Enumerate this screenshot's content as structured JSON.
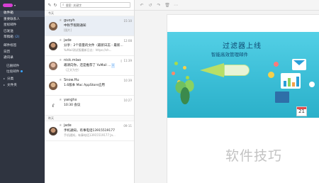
{
  "sidebar": {
    "items": [
      {
        "label": "收件箱",
        "active": true
      },
      {
        "label": "重要联系人"
      },
      {
        "label": "星标邮件"
      },
      {
        "label": "已发送"
      },
      {
        "label": "草稿箱",
        "count": "(2)"
      },
      {
        "label": "邮件标签"
      },
      {
        "label": "日历"
      },
      {
        "label": "通讯录"
      },
      {
        "label": "已删邮件"
      },
      {
        "label": "垃圾邮件"
      },
      {
        "label": "分类"
      },
      {
        "label": "文件夹"
      }
    ]
  },
  "list": {
    "search_placeholder": "搜索: 关键字",
    "groups": [
      {
        "label": "今天"
      },
      {
        "label": "昨天"
      }
    ],
    "mails": [
      {
        "sender": "guoyh",
        "time": "15:10",
        "subject": "中秋节假期通知",
        "preview": "[图片]"
      },
      {
        "sender": "jade",
        "time": "12:08",
        "subject": "分享：2个容量的文件（最新日志 - 最新...",
        "preview": "YuMail测试版最新日志：https://sh..."
      },
      {
        "sender": "nick.mlao",
        "time": "11:39",
        "subject": "邀请向你，还是推荐了 YuMail ...",
        "preview": "（正文为空）",
        "tag": "2"
      },
      {
        "sender": "Snow.Hu",
        "time": "10:39",
        "subject": "1.6版本 Mac AppStore应用",
        "preview": ""
      },
      {
        "sender": "yanghx",
        "time": "10:27",
        "subject": "10:30 会议",
        "preview": ""
      },
      {
        "sender": "jade",
        "time": "09-11",
        "subject": "手机通知，有事电话13915519177",
        "preview": "手机通知，有事电话13915519177 Ja..."
      }
    ]
  },
  "reader": {
    "banner_title": "过滤器上线",
    "banner_subtitle": "智能高效管理邮件",
    "calendar_day": "21"
  },
  "watermark": "软件技巧",
  "colors": {
    "sidebar_bg": "#2f3440",
    "brand": "#d63fd3",
    "banner_bg": "#39bcd5"
  }
}
